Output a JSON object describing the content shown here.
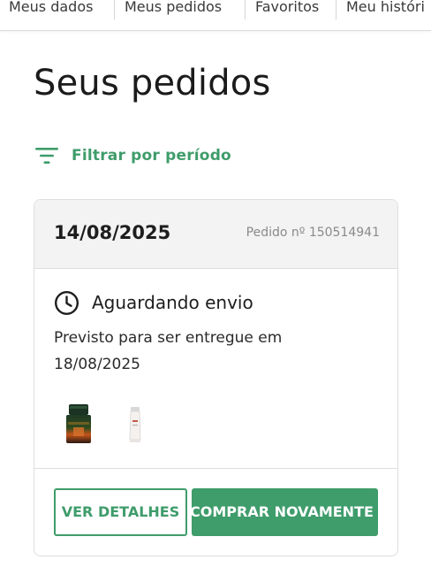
{
  "tabs": [
    {
      "label": "Meus dados"
    },
    {
      "label": "Meus pedidos"
    },
    {
      "label": "Favoritos"
    },
    {
      "label": "Meu históri"
    }
  ],
  "page": {
    "title": "Seus pedidos",
    "filter_label": "Filtrar por período"
  },
  "order": {
    "date": "14/08/2025",
    "number": "Pedido nº 150514941",
    "status": "Aguardando envio",
    "forecast_line1": "Previsto para ser entregue em",
    "forecast_line2": "18/08/2025",
    "products": [
      {
        "name": "perfume-bottle-icon"
      },
      {
        "name": "cream-tube-icon"
      }
    ],
    "details_button": "VER DETALHES",
    "buy_again_button": "COMPRAR NOVAMENTE"
  },
  "colors": {
    "accent": "#3f9c6b",
    "header_bg": "#f3f3f4",
    "border": "#dedede"
  }
}
